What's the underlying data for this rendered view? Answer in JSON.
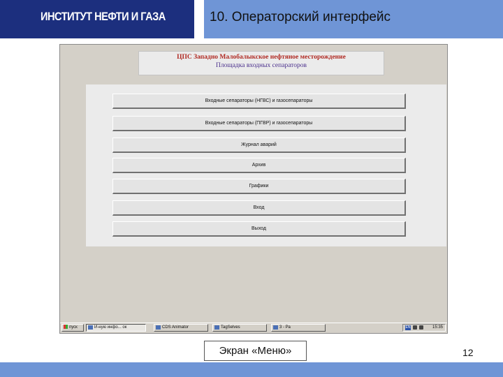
{
  "header": {
    "institute": "ИНСТИТУТ НЕФТИ И ГАЗА",
    "slide_title": "10. Операторский интерфейс"
  },
  "scada": {
    "title": "ЦПС Западно Малобалыкское нефтяное месторождение",
    "subtitle": "Площадка входных сепараторов",
    "menu_buttons": [
      "Входные сепараторы (НГВС) и газосепараторы",
      "Входные сепараторы (ПГВР) и газосепараторы",
      "Журнал аварий",
      "Архив",
      "Графики",
      "Вход",
      "Выход"
    ]
  },
  "taskbar": {
    "start_label": "пуск",
    "tasks": [
      "И-ную инфо... ок",
      "CDS Animator",
      "TagSelves",
      "3 - Ра"
    ],
    "lang": "EN",
    "clock": "15:35"
  },
  "caption": "Экран «Меню»",
  "page_number": "12",
  "colors": {
    "header_dark": "#1c2f7e",
    "header_accent": "#6f95d6",
    "scada_title_red": "#b02a23",
    "scada_subtitle_purple": "#4a2f8c"
  }
}
